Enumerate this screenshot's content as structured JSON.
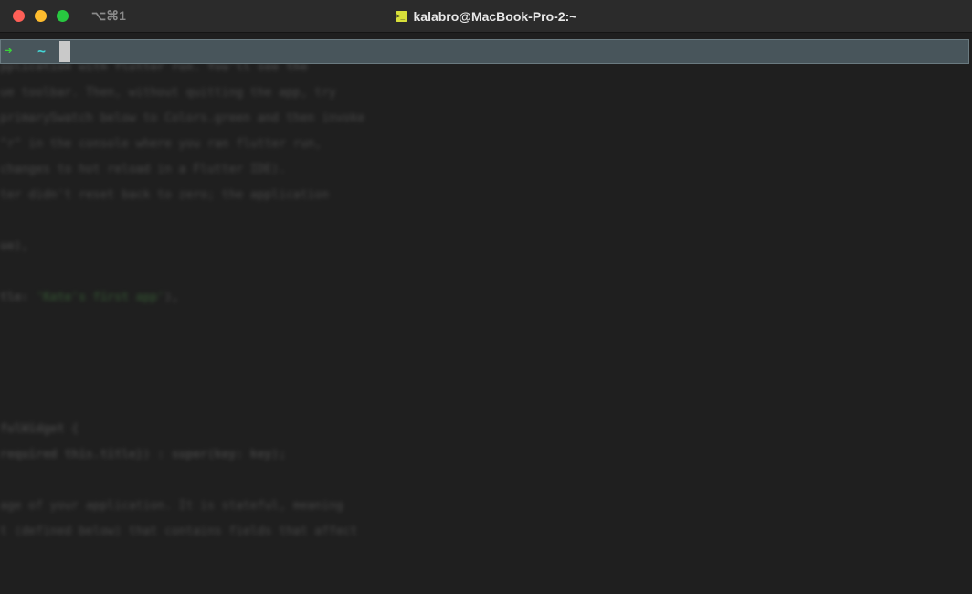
{
  "window": {
    "tab_shortcut": "⌥⌘1",
    "title": "kalabro@MacBook-Pro-2:~"
  },
  "prompt": {
    "arrow": "➜",
    "directory": "~"
  },
  "colors": {
    "close": "#fe5f57",
    "minimize": "#febc2e",
    "maximize": "#28c840",
    "prompt_arrow": "#3ad43a",
    "prompt_dir": "#44d6d6",
    "active_line": "#48555b"
  },
  "icons": {
    "title_icon": "terminal-icon"
  }
}
